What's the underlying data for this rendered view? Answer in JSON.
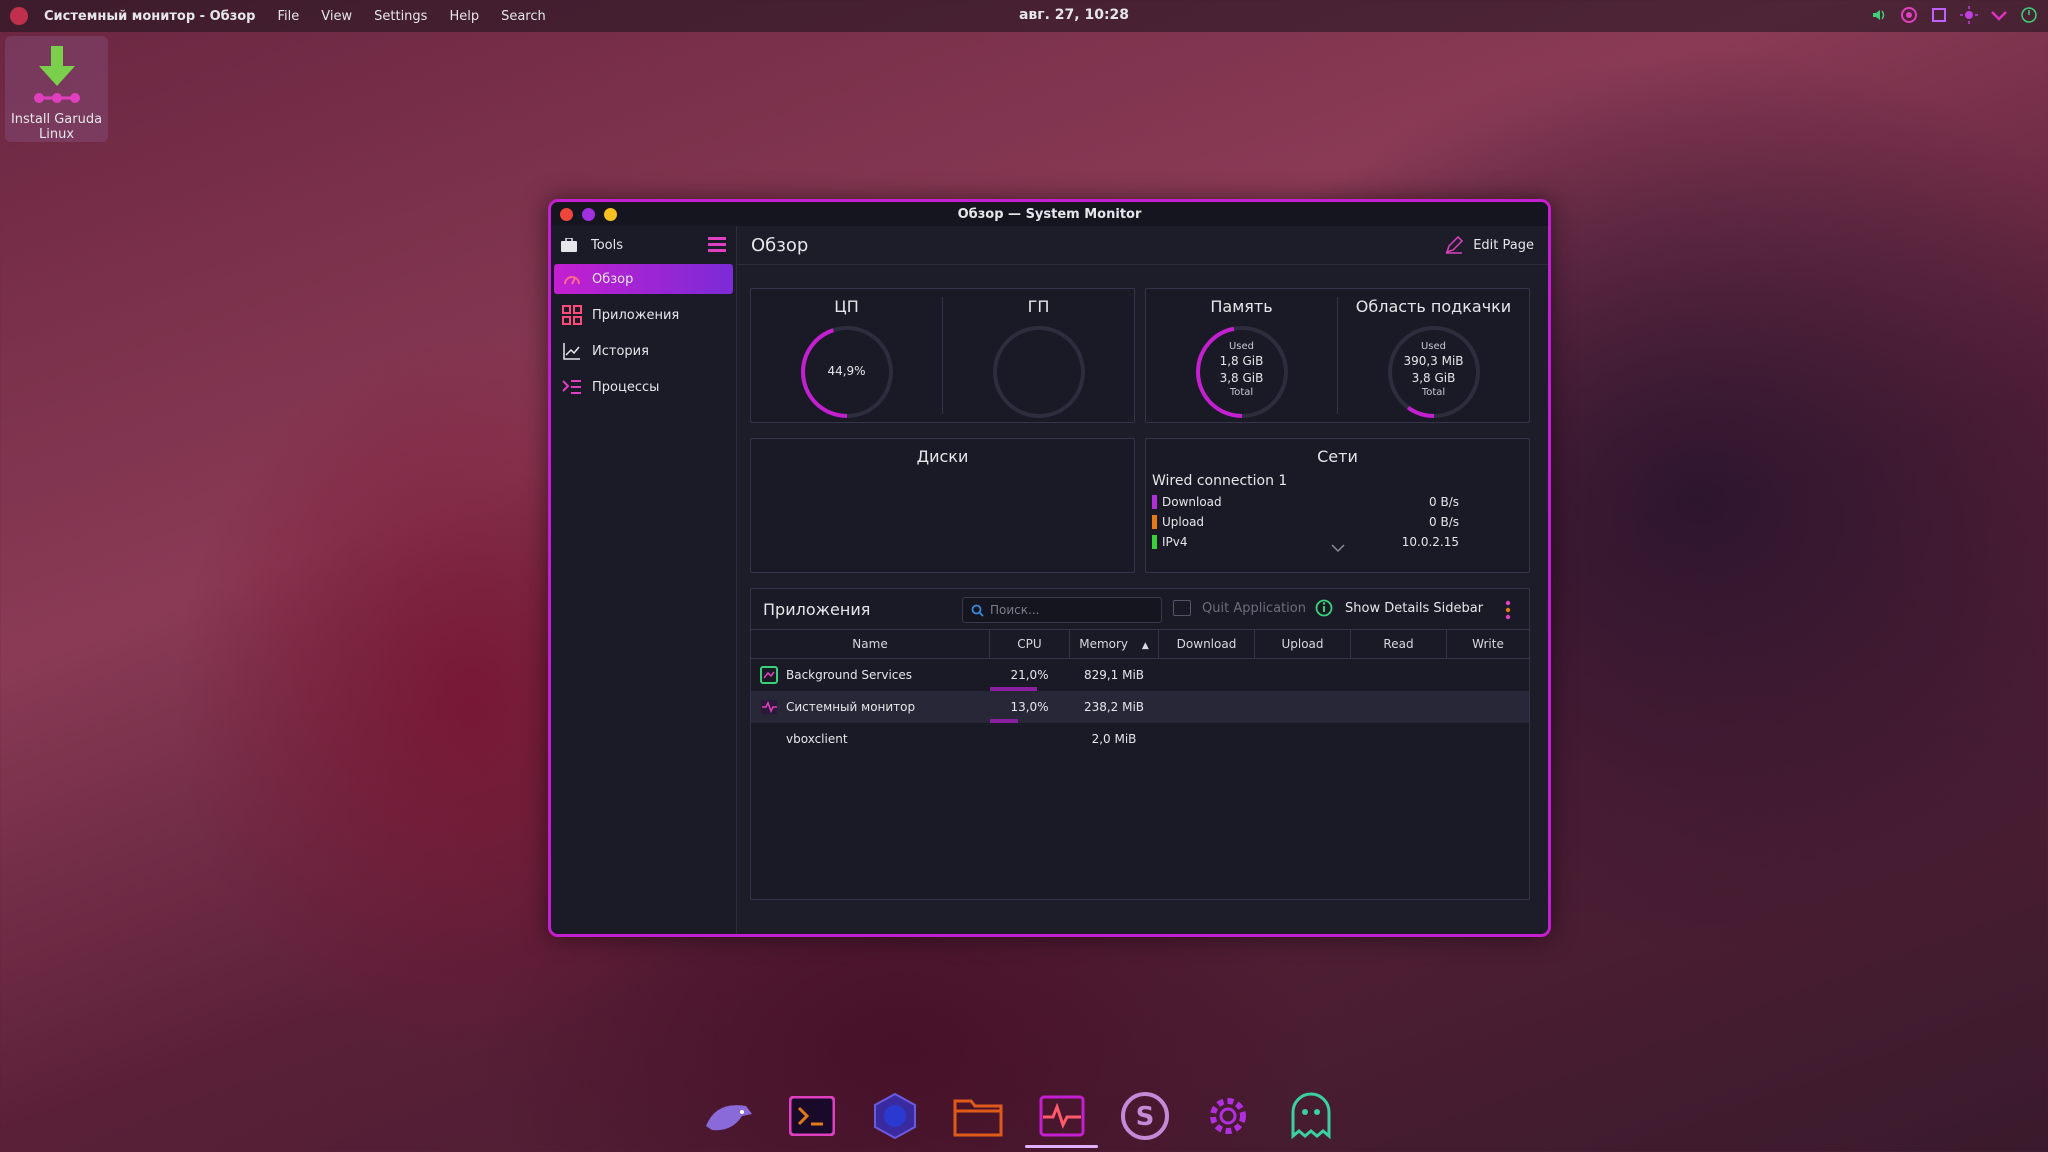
{
  "topbar": {
    "app_title": "Системный монитор - Обзор",
    "menu": [
      "File",
      "View",
      "Settings",
      "Help",
      "Search"
    ],
    "clock": "авг. 27, 10:28"
  },
  "desktop_icon": {
    "label": "Install Garuda Linux"
  },
  "window": {
    "title": "Обзор — System Monitor",
    "sidebar": {
      "tools_label": "Tools",
      "items": [
        {
          "label": "Обзор",
          "icon": "speedometer-icon",
          "active": true
        },
        {
          "label": "Приложения",
          "icon": "applications-grid-icon"
        },
        {
          "label": "История",
          "icon": "history-chart-icon"
        },
        {
          "label": "Процессы",
          "icon": "processes-list-icon"
        }
      ]
    },
    "page_title": "Обзор",
    "edit_page_label": "Edit Page",
    "cards": {
      "cpu": {
        "title": "ЦП",
        "value": "44,9%",
        "fraction": 0.449
      },
      "gpu": {
        "title": "ГП"
      },
      "memory": {
        "title": "Память",
        "used_label": "Used",
        "used": "1,8 GiB",
        "total": "3,8 GiB",
        "total_label": "Total",
        "fraction": 0.47
      },
      "swap": {
        "title": "Область подкачки",
        "used_label": "Used",
        "used": "390,3 MiB",
        "total": "3,8 GiB",
        "total_label": "Total",
        "fraction": 0.1
      },
      "disks": {
        "title": "Диски"
      },
      "network": {
        "title": "Сети",
        "connection": "Wired connection 1",
        "rows": [
          {
            "label": "Download",
            "value": "0 B/s",
            "color": "#b030d8"
          },
          {
            "label": "Upload",
            "value": "0 B/s",
            "color": "#e07a1a"
          },
          {
            "label": "IPv4",
            "value": "10.0.2.15",
            "color": "#3ad03a"
          }
        ]
      }
    },
    "apps": {
      "title": "Приложения",
      "search_placeholder": "Поиск...",
      "quit_label": "Quit Application",
      "details_label": "Show Details Sidebar",
      "columns": [
        "Name",
        "CPU",
        "Memory",
        "Download",
        "Upload",
        "Read",
        "Write"
      ],
      "rows": [
        {
          "name": "Background Services",
          "cpu": "21,0%",
          "cpu_fraction": 0.21,
          "memory": "829,1 MiB"
        },
        {
          "name": "Системный монитор",
          "cpu": "13,0%",
          "cpu_fraction": 0.13,
          "memory": "238,2 MiB"
        },
        {
          "name": "vboxclient",
          "cpu": "",
          "memory": "2,0 MiB"
        }
      ]
    }
  },
  "dock": [
    "garuda-eagle-icon",
    "terminal-icon",
    "garuda-browser-icon",
    "files-folder-icon",
    "system-monitor-icon",
    "sddm-s-icon",
    "settings-gear-icon",
    "ghost-icon"
  ],
  "colors": {
    "accent": "#c41fd0",
    "accent2": "#7b2bd6"
  }
}
